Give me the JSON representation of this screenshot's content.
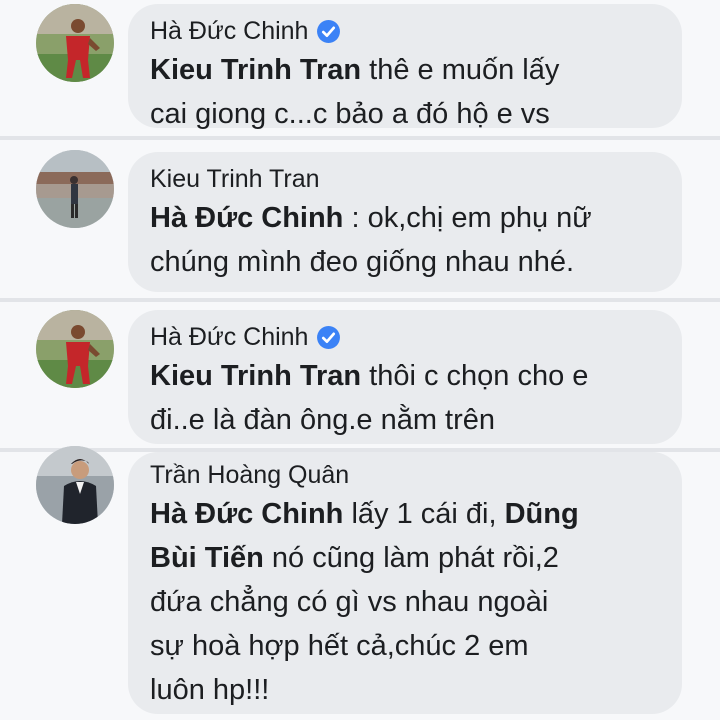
{
  "comments": [
    {
      "author": "Hà Đức Chinh",
      "verified": true,
      "avatar": "player-red-jersey-avatar",
      "lines": [
        [
          {
            "t": "Kieu Trinh Tran",
            "b": true
          },
          {
            "t": " thê e muốn lấy",
            "b": false
          }
        ],
        [
          {
            "t": "cai giong c...c bảo a đó hộ e vs",
            "b": false
          }
        ]
      ]
    },
    {
      "author": "Kieu Trinh Tran",
      "verified": false,
      "avatar": "person-standing-avatar",
      "lines": [
        [
          {
            "t": "Hà Đức Chinh",
            "b": true
          },
          {
            "t": " : ok,chị em phụ nữ",
            "b": false
          }
        ],
        [
          {
            "t": "chúng mình đeo giống nhau nhé.",
            "b": false
          }
        ]
      ]
    },
    {
      "author": "Hà Đức Chinh",
      "verified": true,
      "avatar": "player-red-jersey-avatar",
      "lines": [
        [
          {
            "t": "Kieu Trinh Tran",
            "b": true
          },
          {
            "t": " thôi c chọn cho e",
            "b": false
          }
        ],
        [
          {
            "t": "đi..e là đàn ông.e nằm trên",
            "b": false
          }
        ]
      ]
    },
    {
      "author": "Trần Hoàng Quân",
      "verified": false,
      "avatar": "man-in-suit-avatar",
      "lines": [
        [
          {
            "t": "Hà Đức Chinh",
            "b": true
          },
          {
            "t": " lấy 1 cái đi, ",
            "b": false
          },
          {
            "t": "Dũng",
            "b": true
          }
        ],
        [
          {
            "t": "Bùi Tiến",
            "b": true
          },
          {
            "t": " nó cũng làm phát rồi,2",
            "b": false
          }
        ],
        [
          {
            "t": "đứa chẳng có gì vs nhau ngoài",
            "b": false
          }
        ],
        [
          {
            "t": "sự hoà hợp hết cả,chúc 2 em",
            "b": false
          }
        ],
        [
          {
            "t": "luôn hp!!!",
            "b": false
          }
        ]
      ]
    }
  ],
  "colors": {
    "verified": "#3b82f6",
    "bubble": "#e9ebee",
    "text": "#1c1e21"
  }
}
